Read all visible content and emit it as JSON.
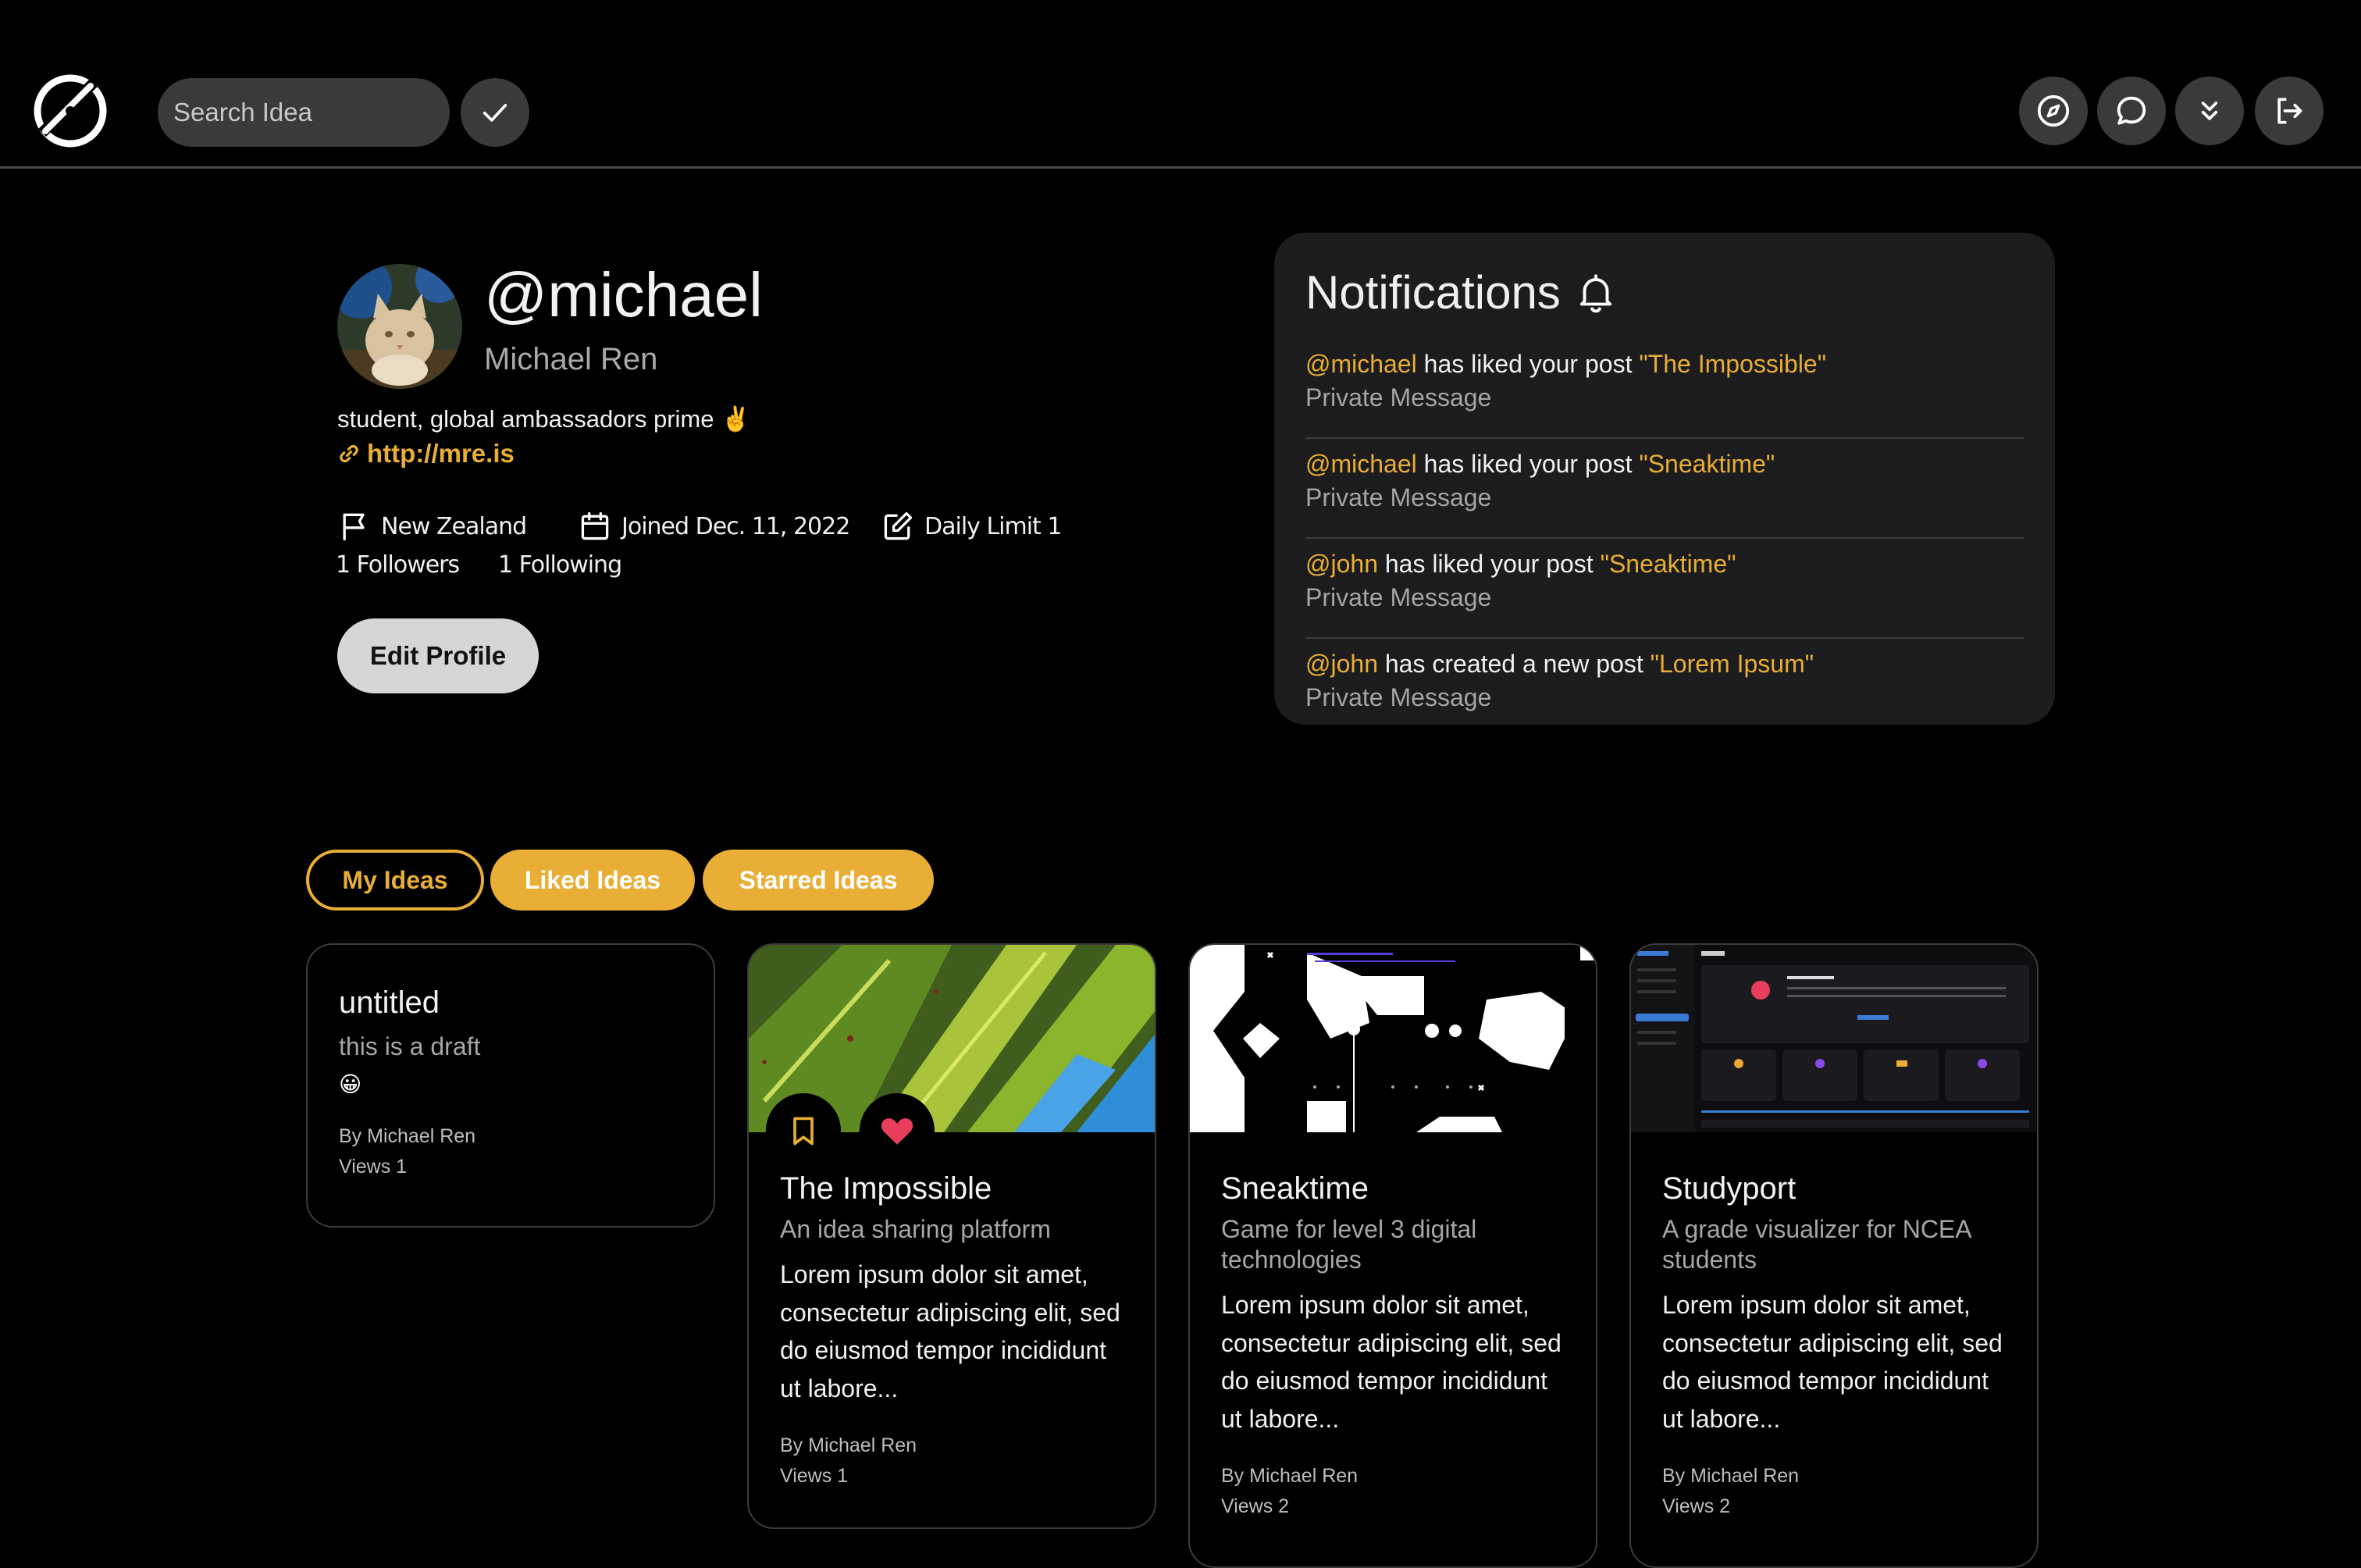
{
  "header": {
    "search_placeholder": "Search Idea",
    "nav_icons": [
      "compass-icon",
      "chat-icon",
      "chevrons-down-icon",
      "logout-icon"
    ]
  },
  "profile": {
    "handle": "@michael",
    "name": "Michael Ren",
    "bio": "student, global ambassadors prime ✌️",
    "link": "http://mre.is",
    "location": "New Zealand",
    "joined": "Joined Dec. 11, 2022",
    "daily_limit": "Daily Limit 1",
    "followers": "1 Followers",
    "following": "1 Following",
    "edit_label": "Edit Profile"
  },
  "notifications": {
    "title": "Notifications",
    "items": [
      {
        "user": "@michael",
        "action": " has liked your post ",
        "post": "\"The Impossible\"",
        "sub": "Private Message"
      },
      {
        "user": "@michael",
        "action": " has liked your post ",
        "post": "\"Sneaktime\"",
        "sub": "Private Message"
      },
      {
        "user": "@john",
        "action": " has liked your post ",
        "post": "\"Sneaktime\"",
        "sub": "Private Message"
      },
      {
        "user": "@john",
        "action": " has created a new post ",
        "post": "\"Lorem Ipsum\"",
        "sub": "Private Message"
      }
    ]
  },
  "tabs": [
    "My Ideas",
    "Liked Ideas",
    "Starred Ideas"
  ],
  "cards": [
    {
      "title": "untitled",
      "subtitle": "this is a draft",
      "emoji": "😀",
      "author": "By Michael Ren",
      "views": "Views 1"
    },
    {
      "title": "The Impossible",
      "subtitle": "An idea sharing platform",
      "desc": "Lorem ipsum dolor sit amet, consectetur adipiscing elit, sed do eiusmod tempor incididunt ut labore...",
      "author": "By Michael Ren",
      "views": "Views 1"
    },
    {
      "title": "Sneaktime",
      "subtitle": "Game for level 3 digital technologies",
      "desc": "Lorem ipsum dolor sit amet, consectetur adipiscing elit, sed do eiusmod tempor incididunt ut labore...",
      "author": "By Michael Ren",
      "views": "Views 2"
    },
    {
      "title": "Studyport",
      "subtitle": "A grade visualizer for NCEA students",
      "desc": "Lorem ipsum dolor sit amet, consectetur adipiscing elit, sed do eiusmod tempor incididunt ut labore...",
      "author": "By Michael Ren",
      "views": "Views 2"
    }
  ],
  "colors": {
    "accent": "#e8ae35",
    "heart": "#e83e5c",
    "card_border": "#3c3c3c"
  }
}
